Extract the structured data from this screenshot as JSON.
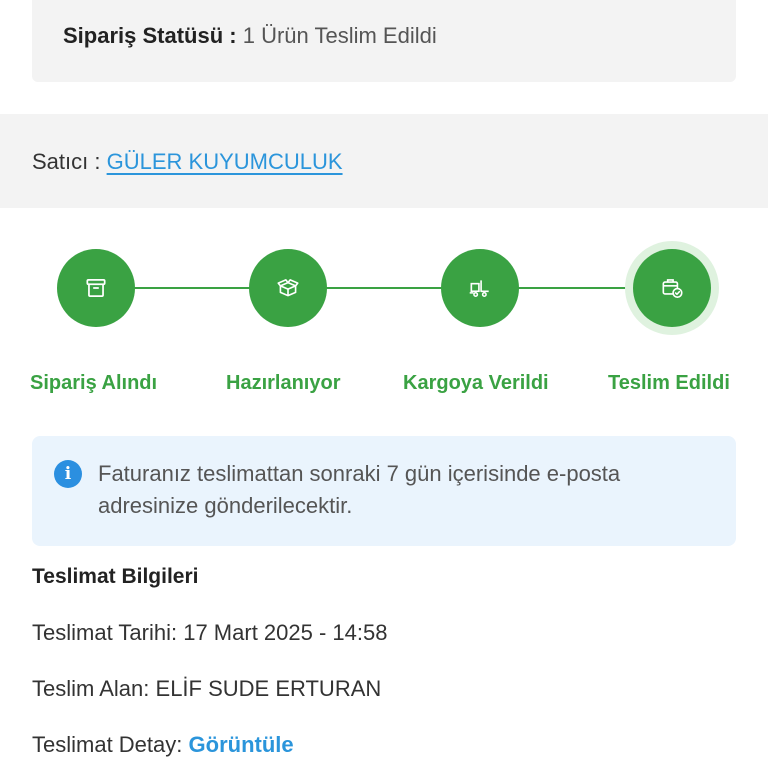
{
  "order_status": {
    "label": "Sipariş Statüsü :",
    "value": "1 Ürün Teslim Edildi"
  },
  "seller": {
    "label": "Satıcı :",
    "name": "GÜLER KUYUMCULUK"
  },
  "steps": [
    {
      "label": "Sipariş Alındı",
      "icon": "box-icon"
    },
    {
      "label": "Hazırlanıyor",
      "icon": "open-box-icon"
    },
    {
      "label": "Kargoya Verildi",
      "icon": "delivery-truck-icon"
    },
    {
      "label": "Teslim Edildi",
      "icon": "delivered-box-check-icon"
    }
  ],
  "colors": {
    "accent_green": "#3aa243",
    "link_blue": "#2b95db",
    "info_bg": "#eaf4fd"
  },
  "info": {
    "icon": "info-icon",
    "text": "Faturanız teslimattan sonraki 7 gün içerisinde e-posta adresinize gönderilecektir."
  },
  "delivery": {
    "title": "Teslimat Bilgileri",
    "date_label": "Teslimat Tarihi:",
    "date_value": "17 Mart 2025 - 14:58",
    "receiver_label": "Teslim Alan:",
    "receiver_value": "ELİF SUDE ERTURAN",
    "detail_label": "Teslimat Detay:",
    "detail_link": "Görüntüle"
  }
}
